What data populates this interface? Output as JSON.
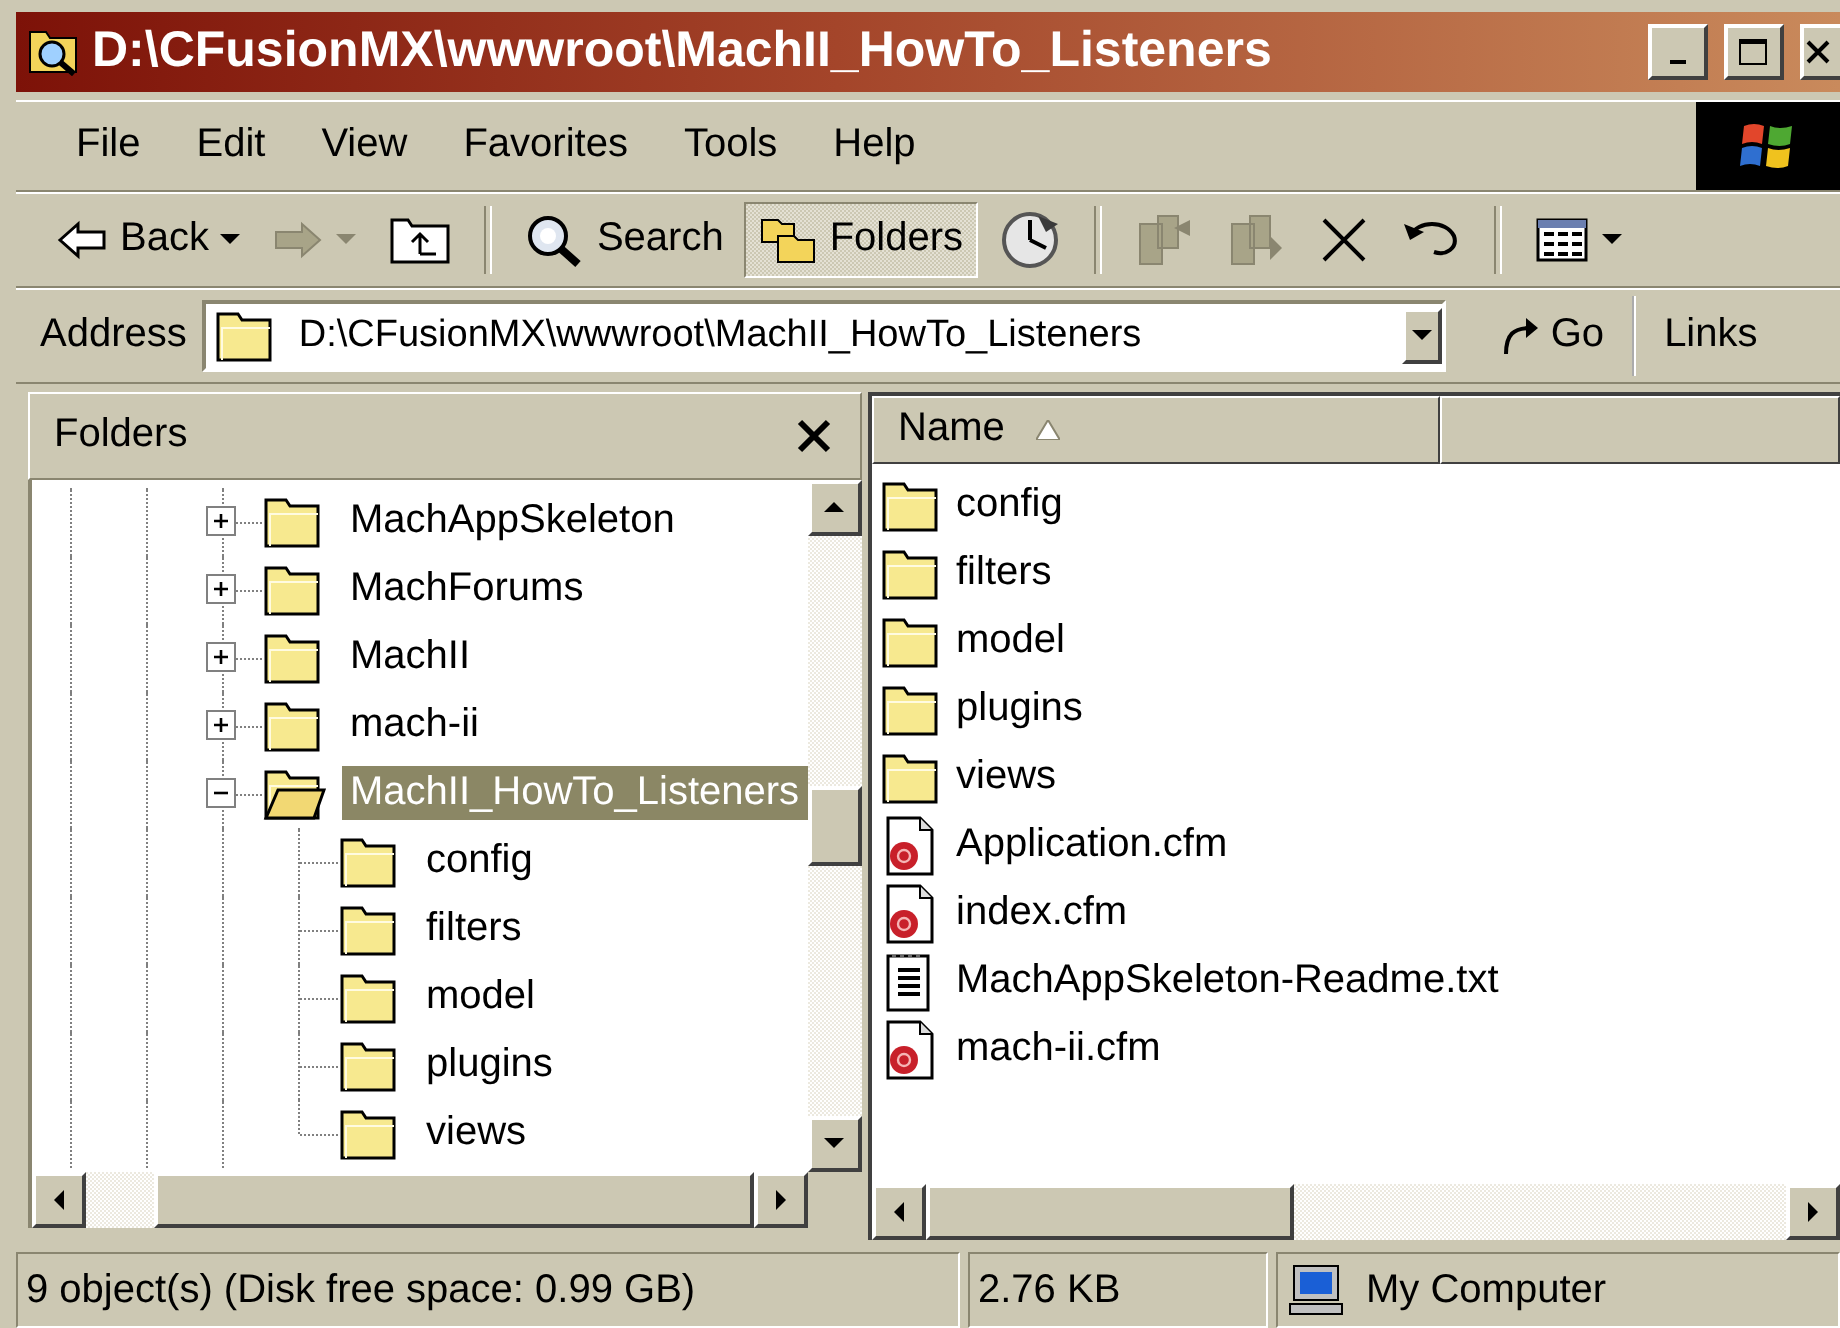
{
  "window": {
    "title": "D:\\CFusionMX\\wwwroot\\MachII_HowTo_Listeners"
  },
  "menu": [
    {
      "label": "File"
    },
    {
      "label": "Edit"
    },
    {
      "label": "View"
    },
    {
      "label": "Favorites"
    },
    {
      "label": "Tools"
    },
    {
      "label": "Help"
    }
  ],
  "toolbar": [
    {
      "kind": "back",
      "label": "Back",
      "disabled": false,
      "pressed": false,
      "dropdown": true
    },
    {
      "kind": "forward",
      "disabled": true,
      "pressed": false,
      "dropdown": true
    },
    {
      "kind": "up",
      "disabled": false,
      "pressed": false,
      "dropdown": false
    },
    {
      "kind": "separator"
    },
    {
      "kind": "search",
      "label": "Search",
      "disabled": false,
      "pressed": false,
      "dropdown": false
    },
    {
      "kind": "folders",
      "label": "Folders",
      "disabled": false,
      "pressed": true,
      "dropdown": false
    },
    {
      "kind": "history",
      "disabled": false,
      "pressed": false,
      "dropdown": false
    },
    {
      "kind": "separator"
    },
    {
      "kind": "move-to",
      "disabled": true,
      "pressed": false,
      "dropdown": false
    },
    {
      "kind": "copy-to",
      "disabled": true,
      "pressed": false,
      "dropdown": false
    },
    {
      "kind": "delete",
      "disabled": false,
      "pressed": false,
      "dropdown": false
    },
    {
      "kind": "undo",
      "disabled": false,
      "pressed": false,
      "dropdown": false
    },
    {
      "kind": "separator"
    },
    {
      "kind": "views",
      "disabled": false,
      "pressed": false,
      "dropdown": true
    }
  ],
  "address": {
    "label": "Address",
    "value": "D:\\CFusionMX\\wwwroot\\MachII_HowTo_Listeners",
    "go": "Go",
    "links": "Links"
  },
  "folders_pane": {
    "title": "Folders",
    "tree": [
      {
        "label": "MachAppSkeleton",
        "expanded": false,
        "selected": false
      },
      {
        "label": "MachForums",
        "expanded": false,
        "selected": false
      },
      {
        "label": "MachII",
        "expanded": false,
        "selected": false
      },
      {
        "label": "mach-ii",
        "expanded": false,
        "selected": false
      },
      {
        "label": "MachII_HowTo_Listeners",
        "expanded": true,
        "selected": true,
        "children": [
          {
            "label": "config",
            "selected": false
          },
          {
            "label": "filters",
            "selected": false
          },
          {
            "label": "model",
            "selected": false
          },
          {
            "label": "plugins",
            "selected": false
          },
          {
            "label": "views",
            "selected": false
          }
        ]
      }
    ]
  },
  "file_list": {
    "columns": [
      {
        "label": "Name",
        "sorted_ascending": true
      }
    ],
    "items": [
      {
        "name": "config",
        "kind": "folder"
      },
      {
        "name": "filters",
        "kind": "folder"
      },
      {
        "name": "model",
        "kind": "folder"
      },
      {
        "name": "plugins",
        "kind": "folder"
      },
      {
        "name": "views",
        "kind": "folder"
      },
      {
        "name": "Application.cfm",
        "kind": "cfm"
      },
      {
        "name": "index.cfm",
        "kind": "cfm"
      },
      {
        "name": "MachAppSkeleton-Readme.txt",
        "kind": "text"
      },
      {
        "name": "mach-ii.cfm",
        "kind": "cfm"
      }
    ]
  },
  "status_bar": {
    "objects": "9 object(s) (Disk free space: 0.99 GB)",
    "size": "2.76 KB",
    "zone": "My Computer"
  }
}
